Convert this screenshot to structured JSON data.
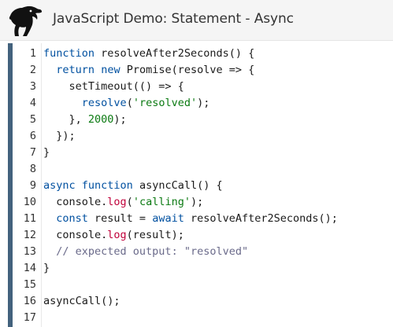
{
  "header": {
    "title": "JavaScript Demo: Statement - Async",
    "logo_icon": "mdn-dinosaur-logo"
  },
  "colors": {
    "keyword": "#0050a0",
    "function_call": "#c0003a",
    "string": "#0b7a12",
    "comment": "#6a6a8a",
    "gutter_accent": "#43627d"
  },
  "editor": {
    "lines": [
      {
        "n": "1",
        "tokens": [
          {
            "t": "kw",
            "v": "function"
          },
          {
            "t": "plain",
            "v": " resolveAfter2Seconds() {"
          }
        ]
      },
      {
        "n": "2",
        "tokens": [
          {
            "t": "plain",
            "v": "  "
          },
          {
            "t": "kw",
            "v": "return"
          },
          {
            "t": "plain",
            "v": " "
          },
          {
            "t": "kw",
            "v": "new"
          },
          {
            "t": "plain",
            "v": " Promise(resolve => {"
          }
        ]
      },
      {
        "n": "3",
        "tokens": [
          {
            "t": "plain",
            "v": "    setTimeout(() => {"
          }
        ]
      },
      {
        "n": "4",
        "tokens": [
          {
            "t": "plain",
            "v": "      "
          },
          {
            "t": "kw",
            "v": "resolve"
          },
          {
            "t": "plain",
            "v": "("
          },
          {
            "t": "str",
            "v": "'resolved'"
          },
          {
            "t": "plain",
            "v": ");"
          }
        ]
      },
      {
        "n": "5",
        "tokens": [
          {
            "t": "plain",
            "v": "    }, "
          },
          {
            "t": "num",
            "v": "2000"
          },
          {
            "t": "plain",
            "v": ");"
          }
        ]
      },
      {
        "n": "6",
        "tokens": [
          {
            "t": "plain",
            "v": "  });"
          }
        ]
      },
      {
        "n": "7",
        "tokens": [
          {
            "t": "plain",
            "v": "}"
          }
        ]
      },
      {
        "n": "8",
        "tokens": []
      },
      {
        "n": "9",
        "tokens": [
          {
            "t": "kw",
            "v": "async"
          },
          {
            "t": "plain",
            "v": " "
          },
          {
            "t": "kw",
            "v": "function"
          },
          {
            "t": "plain",
            "v": " asyncCall() {"
          }
        ]
      },
      {
        "n": "10",
        "tokens": [
          {
            "t": "plain",
            "v": "  console."
          },
          {
            "t": "fn",
            "v": "log"
          },
          {
            "t": "plain",
            "v": "("
          },
          {
            "t": "str",
            "v": "'calling'"
          },
          {
            "t": "plain",
            "v": ");"
          }
        ]
      },
      {
        "n": "11",
        "tokens": [
          {
            "t": "plain",
            "v": "  "
          },
          {
            "t": "kw",
            "v": "const"
          },
          {
            "t": "plain",
            "v": " result = "
          },
          {
            "t": "kw",
            "v": "await"
          },
          {
            "t": "plain",
            "v": " resolveAfter2Seconds();"
          }
        ]
      },
      {
        "n": "12",
        "tokens": [
          {
            "t": "plain",
            "v": "  console."
          },
          {
            "t": "fn",
            "v": "log"
          },
          {
            "t": "plain",
            "v": "(result);"
          }
        ]
      },
      {
        "n": "13",
        "tokens": [
          {
            "t": "plain",
            "v": "  "
          },
          {
            "t": "cmt",
            "v": "// expected output: \"resolved\""
          }
        ]
      },
      {
        "n": "14",
        "tokens": [
          {
            "t": "plain",
            "v": "}"
          }
        ]
      },
      {
        "n": "15",
        "tokens": []
      },
      {
        "n": "16",
        "tokens": [
          {
            "t": "plain",
            "v": "asyncCall();"
          }
        ]
      },
      {
        "n": "17",
        "tokens": []
      }
    ]
  }
}
